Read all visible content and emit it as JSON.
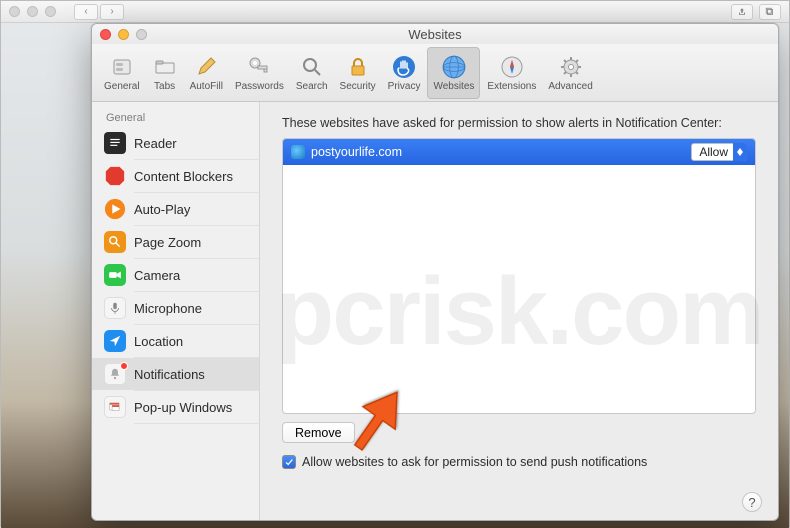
{
  "prefs": {
    "title": "Websites",
    "toolbar": {
      "general": "General",
      "tabs": "Tabs",
      "autofill": "AutoFill",
      "passwords": "Passwords",
      "search": "Search",
      "security": "Security",
      "privacy": "Privacy",
      "websites": "Websites",
      "extensions": "Extensions",
      "advanced": "Advanced"
    },
    "sidebar": {
      "header": "General",
      "items": [
        {
          "label": "Reader"
        },
        {
          "label": "Content Blockers"
        },
        {
          "label": "Auto-Play"
        },
        {
          "label": "Page Zoom"
        },
        {
          "label": "Camera"
        },
        {
          "label": "Microphone"
        },
        {
          "label": "Location"
        },
        {
          "label": "Notifications"
        },
        {
          "label": "Pop-up Windows"
        }
      ]
    },
    "main": {
      "instruction": "These websites have asked for permission to show alerts in Notification Center:",
      "rows": [
        {
          "domain": "postyourlife.com",
          "permission": "Allow"
        }
      ],
      "remove_label": "Remove",
      "checkbox_label": "Allow websites to ask for permission to send push notifications",
      "help_label": "?"
    }
  }
}
